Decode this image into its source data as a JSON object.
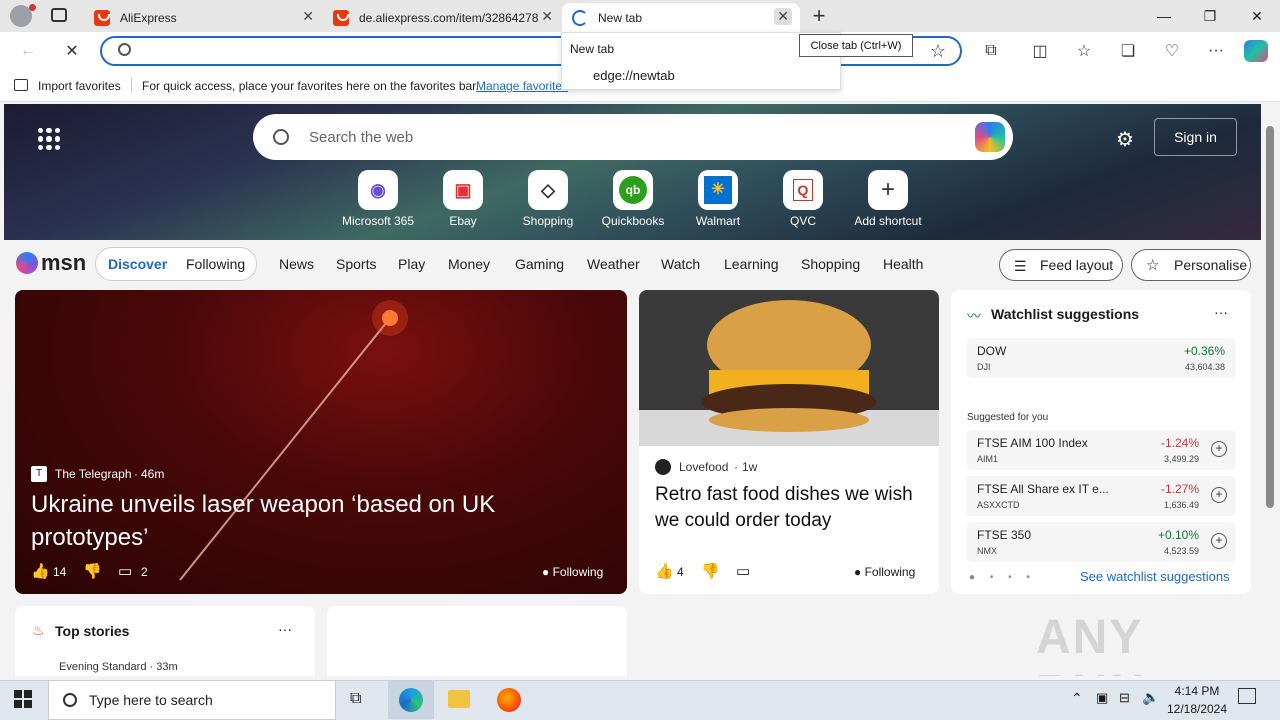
{
  "tabs": [
    {
      "title": "AliExpress"
    },
    {
      "title": "de.aliexpress.com/item/32864278"
    },
    {
      "title": "New tab"
    }
  ],
  "tooltip": "Close tab (Ctrl+W)",
  "dropdown": {
    "title": "New tab",
    "url": "edge://newtab"
  },
  "favbar": {
    "import": "Import favorites",
    "hint": "For quick access, place your favorites here on the favorites bar.",
    "manage": "Manage favorites"
  },
  "newtab": {
    "search_placeholder": "Search the web",
    "sign_in": "Sign in",
    "shortcuts": [
      "Microsoft 365",
      "Ebay",
      "Shopping",
      "Quickbooks",
      "Walmart",
      "QVC",
      "Add shortcut"
    ]
  },
  "nav": {
    "logo": "msn",
    "discover": "Discover",
    "following": "Following",
    "items": [
      "News",
      "Sports",
      "Play",
      "Money",
      "Gaming",
      "Weather",
      "Watch",
      "Learning",
      "Shopping",
      "Health"
    ],
    "feed_layout": "Feed layout",
    "personalise": "Personalise"
  },
  "main_story": {
    "source": "The Telegraph",
    "age": "46m",
    "headline": "Ukraine unveils laser weapon ‘based on UK prototypes’",
    "likes": "14",
    "comments": "2",
    "follow": "Following"
  },
  "food_story": {
    "source": "Lovefood",
    "age": "1w",
    "headline": "Retro fast food dishes we wish we could order today",
    "likes": "4",
    "follow": "Following"
  },
  "watchlist": {
    "title": "Watchlist suggestions",
    "dow": {
      "name": "DOW",
      "symbol": "DJI",
      "change": "+0.36%",
      "price": "43,604.38"
    },
    "suggested_label": "Suggested for you",
    "items": [
      {
        "name": "FTSE AIM 100 Index",
        "symbol": "AIM1",
        "change": "-1.24%",
        "price": "3,499.29"
      },
      {
        "name": "FTSE All Share ex IT e...",
        "symbol": "ASXXCTD",
        "change": "-1.27%",
        "price": "1,636.49"
      },
      {
        "name": "FTSE 350",
        "symbol": "NMX",
        "change": "+0.10%",
        "price": "4,523.59"
      }
    ],
    "see_more": "See watchlist suggestions"
  },
  "top_stories": {
    "title": "Top stories",
    "source_line": "Evening Standard · 33m"
  },
  "taskbar": {
    "search_placeholder": "Type here to search",
    "time": "4:14 PM",
    "date": "12/18/2024"
  },
  "watermark": "ANY RUN",
  "colors": {
    "accent": "#1b6ac9",
    "positive": "#0b7a2f",
    "negative": "#d13438"
  }
}
